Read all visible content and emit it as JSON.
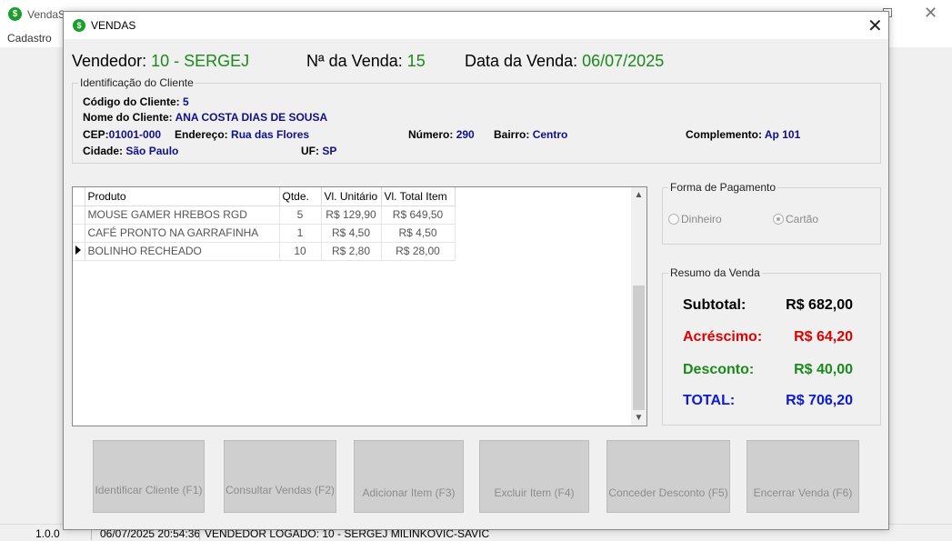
{
  "main_window": {
    "title": "VendaS",
    "app_icon": "dollar-icon",
    "menu": [
      "Cadastro"
    ]
  },
  "status_bar": {
    "version": "1.0.0",
    "datetime": "06/07/2025 20:54:36",
    "vendor": "VENDEDOR LOGADO:  10 - SERGEJ MILINKOVIC-SAVIC"
  },
  "dialog": {
    "title": "VENDAS",
    "header": {
      "vendedor_label": "Vendedor:",
      "vendedor_value": "10 - SERGEJ",
      "venda_label": "Nª da Venda:",
      "venda_value": "15",
      "data_label": "Data da Venda:",
      "data_value": "06/07/2025"
    },
    "cliente": {
      "legend": "Identificação do Cliente",
      "codigo_label": "Código do Cliente:",
      "codigo": "5",
      "nome_label": "Nome do Cliente:",
      "nome": "ANA COSTA DIAS DE SOUSA",
      "cep_label": "CEP:",
      "cep": "01001-000",
      "endereco_label": "Endereço:",
      "endereco": "Rua das Flores",
      "numero_label": "Número:",
      "numero": "290",
      "bairro_label": "Bairro:",
      "bairro": "Centro",
      "complemento_label": "Complemento:",
      "complemento": "Ap 101",
      "cidade_label": "Cidade:",
      "cidade": "São Paulo",
      "uf_label": "UF:",
      "uf": "SP"
    },
    "grid": {
      "columns": [
        "Produto",
        "Qtde.",
        "Vl. Unitário",
        "Vl. Total Item"
      ],
      "rows": [
        [
          "MOUSE GAMER HREBOS RGD",
          "5",
          "R$ 129,90",
          "R$ 649,50"
        ],
        [
          "CAFÉ PRONTO NA GARRAFINHA",
          "1",
          "R$ 4,50",
          "R$ 4,50"
        ],
        [
          "BOLINHO RECHEADO",
          "10",
          "R$ 2,80",
          "R$ 28,00"
        ]
      ],
      "current_row": 2
    },
    "pagamento": {
      "legend": "Forma de Pagamento",
      "options": [
        "Dinheiro",
        "Cartão"
      ],
      "selected": "Cartão"
    },
    "resumo": {
      "legend": "Resumo da Venda",
      "subtotal_label": "Subtotal:",
      "subtotal": "R$ 682,00",
      "acrescimo_label": "Acréscimo:",
      "acrescimo": "R$ 64,20",
      "desconto_label": "Desconto:",
      "desconto": "R$ 40,00",
      "total_label": "TOTAL:",
      "total": "R$ 706,20"
    },
    "buttons": [
      "Identificar Cliente (F1)",
      "Consultar Vendas (F2)",
      "Adicionar Item (F3)",
      "Excluir Item (F4)",
      "Conceder Desconto (F5)",
      "Encerrar Venda (F6)"
    ]
  },
  "colors": {
    "green_value": "#1a8a1a",
    "client_value": "#10108a",
    "acrescimo": "#e00000",
    "desconto": "#1a8a1a",
    "total": "#0a1ad8"
  }
}
